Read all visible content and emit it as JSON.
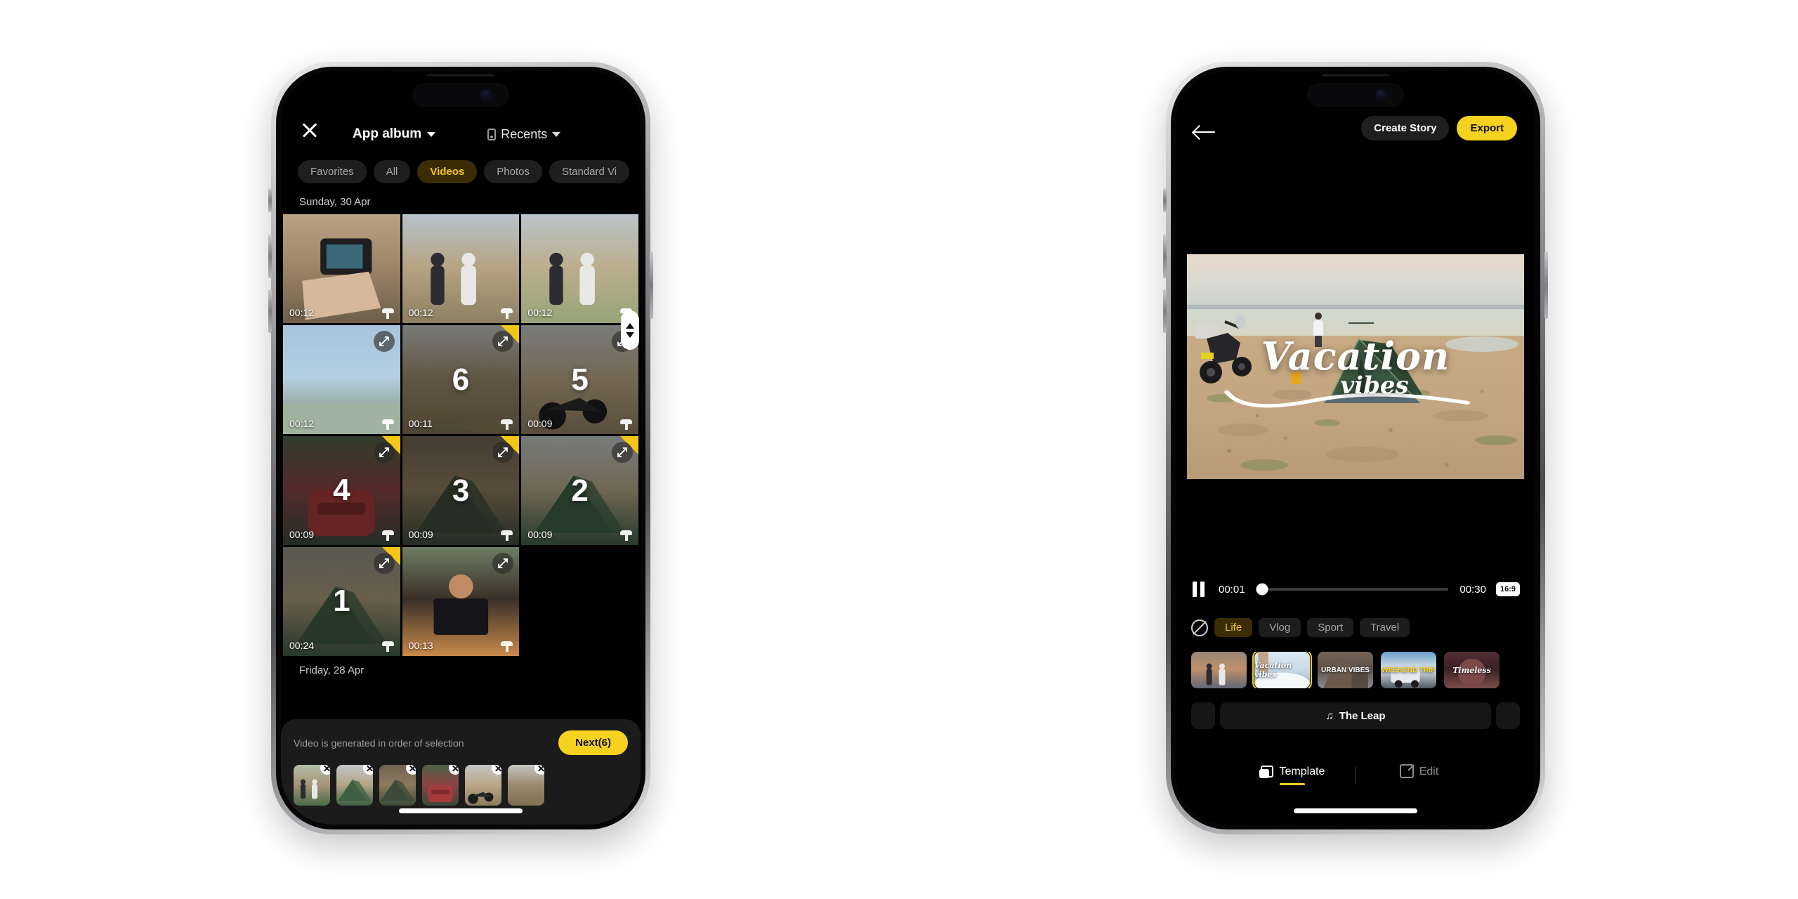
{
  "left_phone": {
    "header": {
      "close_icon": "close-icon",
      "album_label": "App album",
      "album_chevron": "chevron-down-icon",
      "source_icon": "phone-icon",
      "source_label": "Recents",
      "source_chevron": "chevron-down-icon"
    },
    "filter_chips": [
      {
        "label": "Favorites",
        "active": false
      },
      {
        "label": "All",
        "active": false
      },
      {
        "label": "Videos",
        "active": true
      },
      {
        "label": "Photos",
        "active": false
      },
      {
        "label": "Standard Vi",
        "active": false
      }
    ],
    "date_header": "Sunday, 30 Apr",
    "next_date_header": "Friday, 28 Apr",
    "grid_items": [
      {
        "duration": "00:12",
        "selection": "",
        "selected": false,
        "scene": "hand-camera"
      },
      {
        "duration": "00:12",
        "selection": "",
        "selected": false,
        "scene": "two-men-tent"
      },
      {
        "duration": "00:12",
        "selection": "",
        "selected": false,
        "scene": "beach-walkers"
      },
      {
        "duration": "00:12",
        "selection": "",
        "selected": false,
        "scene": "sky-lake"
      },
      {
        "duration": "00:11",
        "selection": "6",
        "selected": true,
        "scene": "dry-lakebed"
      },
      {
        "duration": "00:09",
        "selection": "5",
        "selected": true,
        "scene": "motorbike-camp"
      },
      {
        "duration": "00:09",
        "selection": "4",
        "selected": true,
        "scene": "red-bag-tent"
      },
      {
        "duration": "00:09",
        "selection": "3",
        "selected": true,
        "scene": "sunset-tent"
      },
      {
        "duration": "00:09",
        "selection": "2",
        "selected": true,
        "scene": "green-tent-shore"
      },
      {
        "duration": "00:24",
        "selection": "1",
        "selected": true,
        "scene": "tent-field"
      },
      {
        "duration": "00:13",
        "selection": "",
        "selected": false,
        "scene": "cafe-laptop"
      }
    ],
    "sheet": {
      "hint": "Video is generated in order of selection",
      "next_label": "Next(6)",
      "selected_thumbs": [
        {
          "scene": "camp-people"
        },
        {
          "scene": "green-tent-shore"
        },
        {
          "scene": "sunset-tent"
        },
        {
          "scene": "red-bag-tent"
        },
        {
          "scene": "motorbike-camp"
        },
        {
          "scene": "dry-lakebed"
        }
      ]
    },
    "scroll_handle_icon": "drag-handle-icon"
  },
  "right_phone": {
    "header": {
      "back_icon": "back-arrow-icon",
      "create_story_label": "Create Story",
      "export_label": "Export"
    },
    "preview": {
      "title_main": "Vacation",
      "title_sub": "vibes"
    },
    "controls": {
      "pause_icon": "pause-icon",
      "current_time": "00:01",
      "total_time": "00:30",
      "progress_percent": 3,
      "aspect_ratio": "16:9"
    },
    "categories": {
      "none_icon": "no-template-icon",
      "items": [
        {
          "label": "Life",
          "active": true
        },
        {
          "label": "Vlog",
          "active": false
        },
        {
          "label": "Sport",
          "active": false
        },
        {
          "label": "Travel",
          "active": false
        }
      ]
    },
    "templates": [
      {
        "label": "",
        "selected": false,
        "scene": "family-selfie"
      },
      {
        "label": "Vacation vibes",
        "selected": true,
        "scene": "snow-vacation"
      },
      {
        "label": "URBAN VIBES",
        "selected": false,
        "scene": "urban-building"
      },
      {
        "label": "WEEKEND TRIP",
        "selected": false,
        "scene": "weekend-van"
      },
      {
        "label": "Timeless",
        "selected": false,
        "scene": "timeless-portrait"
      }
    ],
    "music": {
      "note_icon": "music-note-icon",
      "track_name": "The Leap"
    },
    "tabs": [
      {
        "label": "Template",
        "icon": "template-icon",
        "active": true
      },
      {
        "label": "Edit",
        "icon": "edit-icon",
        "active": false
      }
    ]
  },
  "colors": {
    "accent_yellow": "#f5d21e",
    "chip_active_bg": "#3a2c05",
    "chip_active_text": "#f5c518",
    "screen_bg": "#000000"
  }
}
